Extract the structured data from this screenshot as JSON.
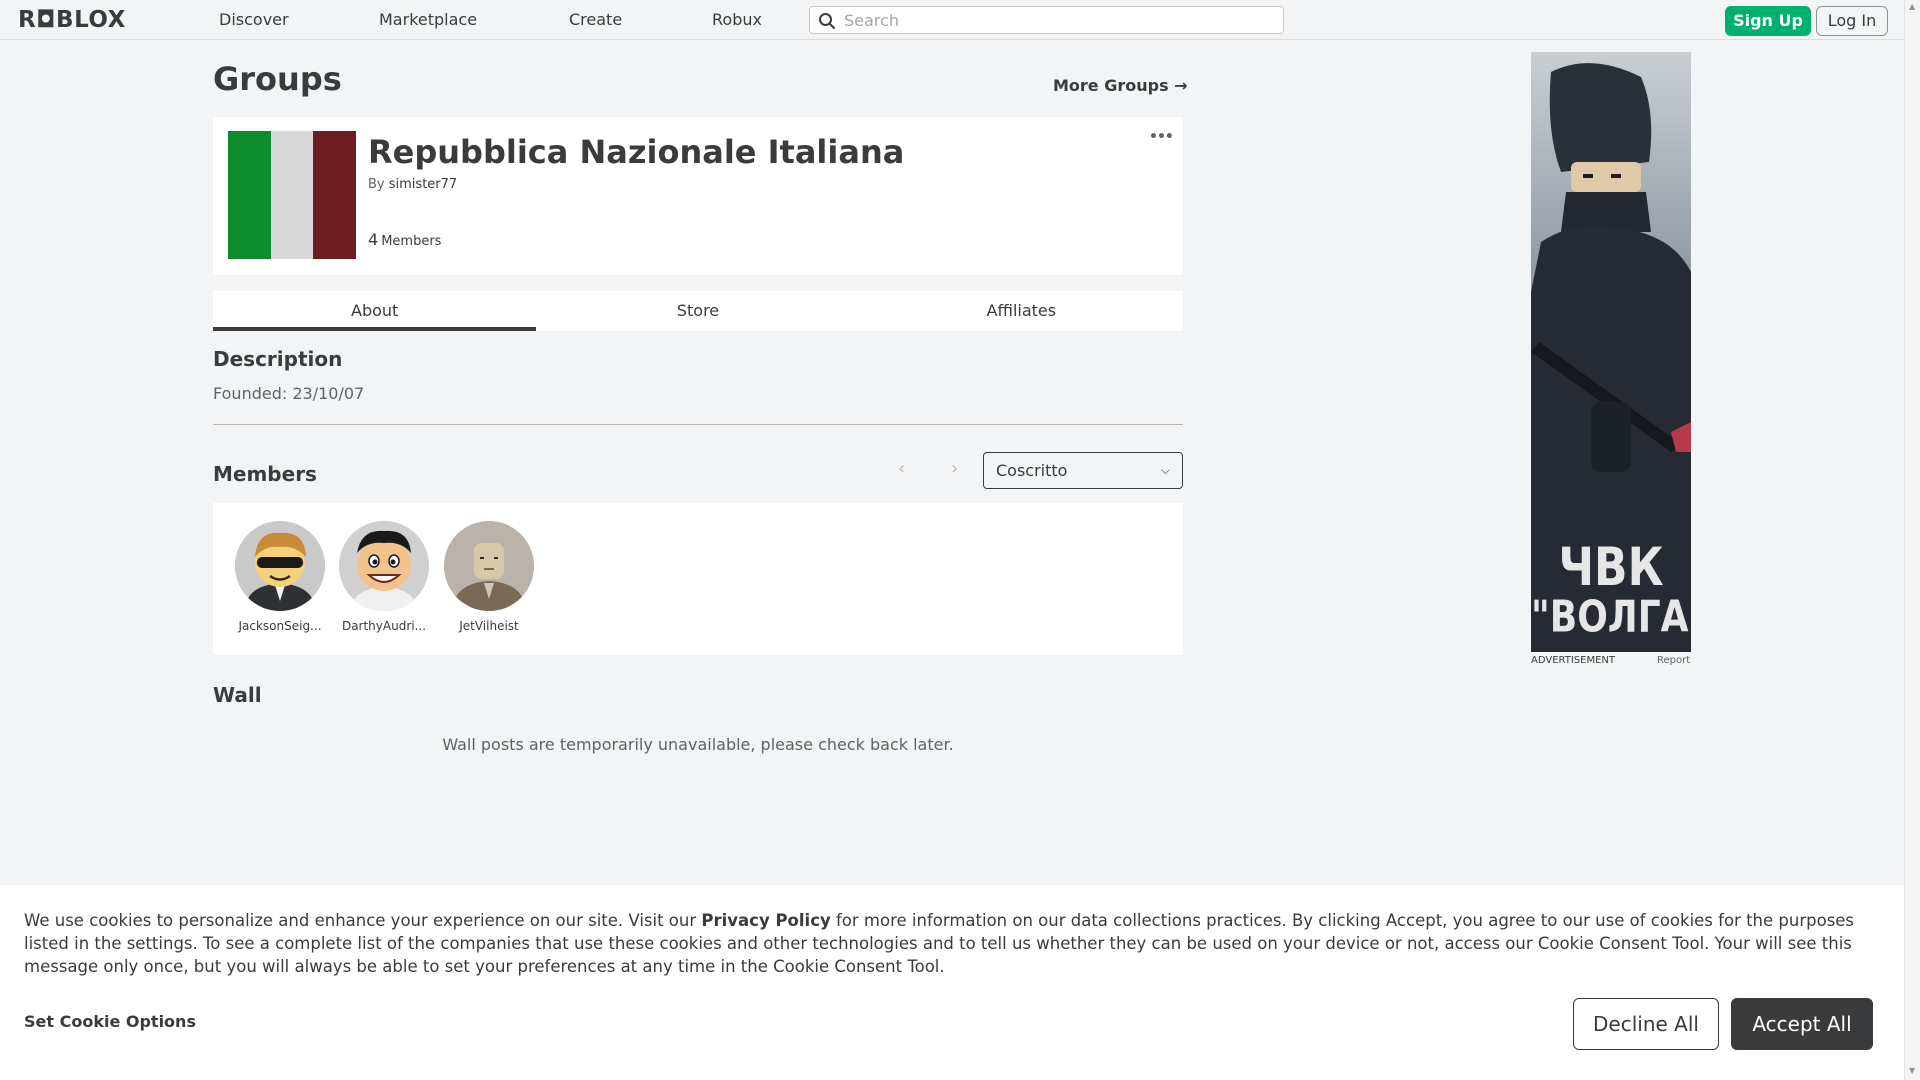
{
  "header": {
    "logo": "R◘BLOX",
    "nav": [
      "Discover",
      "Marketplace",
      "Create",
      "Robux"
    ],
    "search_placeholder": "Search",
    "signup_label": "Sign Up",
    "login_label": "Log In"
  },
  "page": {
    "title": "Groups",
    "more_groups": "More Groups →"
  },
  "group": {
    "name": "Repubblica Nazionale Italiana",
    "by_label": "By",
    "owner": "simister77",
    "member_count": "4",
    "member_label": "Members",
    "flag_colors": [
      "#0d8c2d",
      "#d9d9d9",
      "#6d1d22"
    ]
  },
  "tabs": [
    {
      "label": "About",
      "active": true
    },
    {
      "label": "Store",
      "active": false
    },
    {
      "label": "Affiliates",
      "active": false
    }
  ],
  "description": {
    "title": "Description",
    "text": "Founded: 23/10/07"
  },
  "members": {
    "title": "Members",
    "role_selected": "Coscritto",
    "list": [
      {
        "name": "JacksonSeig..."
      },
      {
        "name": "DarthyAudri..."
      },
      {
        "name": "JetVilheist"
      }
    ]
  },
  "wall": {
    "title": "Wall",
    "message": "Wall posts are temporarily unavailable, please check back later."
  },
  "ad": {
    "text_line1": "ЧВК",
    "text_line2": "\"ВОЛГА\"",
    "footer_left": "ADVERTISEMENT",
    "footer_right": "Report"
  },
  "cookie": {
    "text_before": "We use cookies to personalize and enhance your experience on our site. Visit our ",
    "privacy_link": "Privacy Policy",
    "text_after": " for more information on our data collections practices. By clicking Accept, you agree to our use of cookies for the purposes listed in the settings. To see a complete list of the companies that use these cookies and other technologies and to tell us whether they can be used on your device or not, access our Cookie Consent Tool. Your will see this message only once, but you will always be able to set your preferences at any time in the Cookie Consent Tool.",
    "options_label": "Set Cookie Options",
    "decline_label": "Decline All",
    "accept_label": "Accept All"
  }
}
